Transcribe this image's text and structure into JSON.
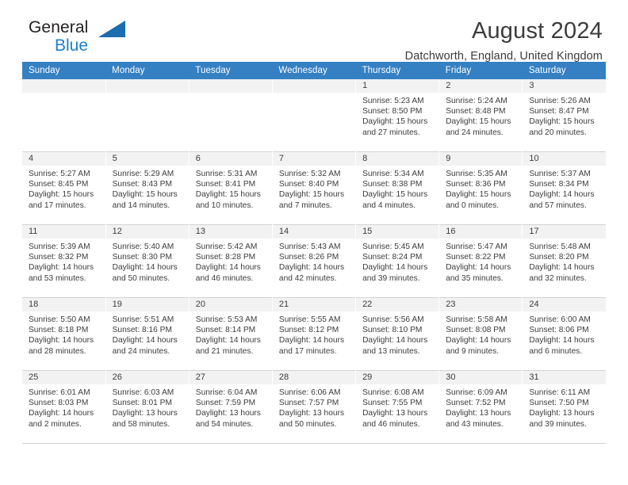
{
  "brand": {
    "name_top": "General",
    "name_bottom": "Blue",
    "triangle_icon": "triangle-icon",
    "accent_color": "#1b7fd0"
  },
  "header": {
    "title": "August 2024",
    "location": "Datchworth, England, United Kingdom",
    "header_bg_color": "#3580c3",
    "daynum_band_color": "#f2f2f2"
  },
  "calendar": {
    "weekday_headers": [
      "Sunday",
      "Monday",
      "Tuesday",
      "Wednesday",
      "Thursday",
      "Friday",
      "Saturday"
    ],
    "weeks": [
      [
        {
          "day": "",
          "lines": []
        },
        {
          "day": "",
          "lines": []
        },
        {
          "day": "",
          "lines": []
        },
        {
          "day": "",
          "lines": []
        },
        {
          "day": "1",
          "lines": [
            "Sunrise: 5:23 AM",
            "Sunset: 8:50 PM",
            "Daylight: 15 hours",
            "and 27 minutes."
          ]
        },
        {
          "day": "2",
          "lines": [
            "Sunrise: 5:24 AM",
            "Sunset: 8:48 PM",
            "Daylight: 15 hours",
            "and 24 minutes."
          ]
        },
        {
          "day": "3",
          "lines": [
            "Sunrise: 5:26 AM",
            "Sunset: 8:47 PM",
            "Daylight: 15 hours",
            "and 20 minutes."
          ]
        }
      ],
      [
        {
          "day": "4",
          "lines": [
            "Sunrise: 5:27 AM",
            "Sunset: 8:45 PM",
            "Daylight: 15 hours",
            "and 17 minutes."
          ]
        },
        {
          "day": "5",
          "lines": [
            "Sunrise: 5:29 AM",
            "Sunset: 8:43 PM",
            "Daylight: 15 hours",
            "and 14 minutes."
          ]
        },
        {
          "day": "6",
          "lines": [
            "Sunrise: 5:31 AM",
            "Sunset: 8:41 PM",
            "Daylight: 15 hours",
            "and 10 minutes."
          ]
        },
        {
          "day": "7",
          "lines": [
            "Sunrise: 5:32 AM",
            "Sunset: 8:40 PM",
            "Daylight: 15 hours",
            "and 7 minutes."
          ]
        },
        {
          "day": "8",
          "lines": [
            "Sunrise: 5:34 AM",
            "Sunset: 8:38 PM",
            "Daylight: 15 hours",
            "and 4 minutes."
          ]
        },
        {
          "day": "9",
          "lines": [
            "Sunrise: 5:35 AM",
            "Sunset: 8:36 PM",
            "Daylight: 15 hours",
            "and 0 minutes."
          ]
        },
        {
          "day": "10",
          "lines": [
            "Sunrise: 5:37 AM",
            "Sunset: 8:34 PM",
            "Daylight: 14 hours",
            "and 57 minutes."
          ]
        }
      ],
      [
        {
          "day": "11",
          "lines": [
            "Sunrise: 5:39 AM",
            "Sunset: 8:32 PM",
            "Daylight: 14 hours",
            "and 53 minutes."
          ]
        },
        {
          "day": "12",
          "lines": [
            "Sunrise: 5:40 AM",
            "Sunset: 8:30 PM",
            "Daylight: 14 hours",
            "and 50 minutes."
          ]
        },
        {
          "day": "13",
          "lines": [
            "Sunrise: 5:42 AM",
            "Sunset: 8:28 PM",
            "Daylight: 14 hours",
            "and 46 minutes."
          ]
        },
        {
          "day": "14",
          "lines": [
            "Sunrise: 5:43 AM",
            "Sunset: 8:26 PM",
            "Daylight: 14 hours",
            "and 42 minutes."
          ]
        },
        {
          "day": "15",
          "lines": [
            "Sunrise: 5:45 AM",
            "Sunset: 8:24 PM",
            "Daylight: 14 hours",
            "and 39 minutes."
          ]
        },
        {
          "day": "16",
          "lines": [
            "Sunrise: 5:47 AM",
            "Sunset: 8:22 PM",
            "Daylight: 14 hours",
            "and 35 minutes."
          ]
        },
        {
          "day": "17",
          "lines": [
            "Sunrise: 5:48 AM",
            "Sunset: 8:20 PM",
            "Daylight: 14 hours",
            "and 32 minutes."
          ]
        }
      ],
      [
        {
          "day": "18",
          "lines": [
            "Sunrise: 5:50 AM",
            "Sunset: 8:18 PM",
            "Daylight: 14 hours",
            "and 28 minutes."
          ]
        },
        {
          "day": "19",
          "lines": [
            "Sunrise: 5:51 AM",
            "Sunset: 8:16 PM",
            "Daylight: 14 hours",
            "and 24 minutes."
          ]
        },
        {
          "day": "20",
          "lines": [
            "Sunrise: 5:53 AM",
            "Sunset: 8:14 PM",
            "Daylight: 14 hours",
            "and 21 minutes."
          ]
        },
        {
          "day": "21",
          "lines": [
            "Sunrise: 5:55 AM",
            "Sunset: 8:12 PM",
            "Daylight: 14 hours",
            "and 17 minutes."
          ]
        },
        {
          "day": "22",
          "lines": [
            "Sunrise: 5:56 AM",
            "Sunset: 8:10 PM",
            "Daylight: 14 hours",
            "and 13 minutes."
          ]
        },
        {
          "day": "23",
          "lines": [
            "Sunrise: 5:58 AM",
            "Sunset: 8:08 PM",
            "Daylight: 14 hours",
            "and 9 minutes."
          ]
        },
        {
          "day": "24",
          "lines": [
            "Sunrise: 6:00 AM",
            "Sunset: 8:06 PM",
            "Daylight: 14 hours",
            "and 6 minutes."
          ]
        }
      ],
      [
        {
          "day": "25",
          "lines": [
            "Sunrise: 6:01 AM",
            "Sunset: 8:03 PM",
            "Daylight: 14 hours",
            "and 2 minutes."
          ]
        },
        {
          "day": "26",
          "lines": [
            "Sunrise: 6:03 AM",
            "Sunset: 8:01 PM",
            "Daylight: 13 hours",
            "and 58 minutes."
          ]
        },
        {
          "day": "27",
          "lines": [
            "Sunrise: 6:04 AM",
            "Sunset: 7:59 PM",
            "Daylight: 13 hours",
            "and 54 minutes."
          ]
        },
        {
          "day": "28",
          "lines": [
            "Sunrise: 6:06 AM",
            "Sunset: 7:57 PM",
            "Daylight: 13 hours",
            "and 50 minutes."
          ]
        },
        {
          "day": "29",
          "lines": [
            "Sunrise: 6:08 AM",
            "Sunset: 7:55 PM",
            "Daylight: 13 hours",
            "and 46 minutes."
          ]
        },
        {
          "day": "30",
          "lines": [
            "Sunrise: 6:09 AM",
            "Sunset: 7:52 PM",
            "Daylight: 13 hours",
            "and 43 minutes."
          ]
        },
        {
          "day": "31",
          "lines": [
            "Sunrise: 6:11 AM",
            "Sunset: 7:50 PM",
            "Daylight: 13 hours",
            "and 39 minutes."
          ]
        }
      ]
    ]
  }
}
